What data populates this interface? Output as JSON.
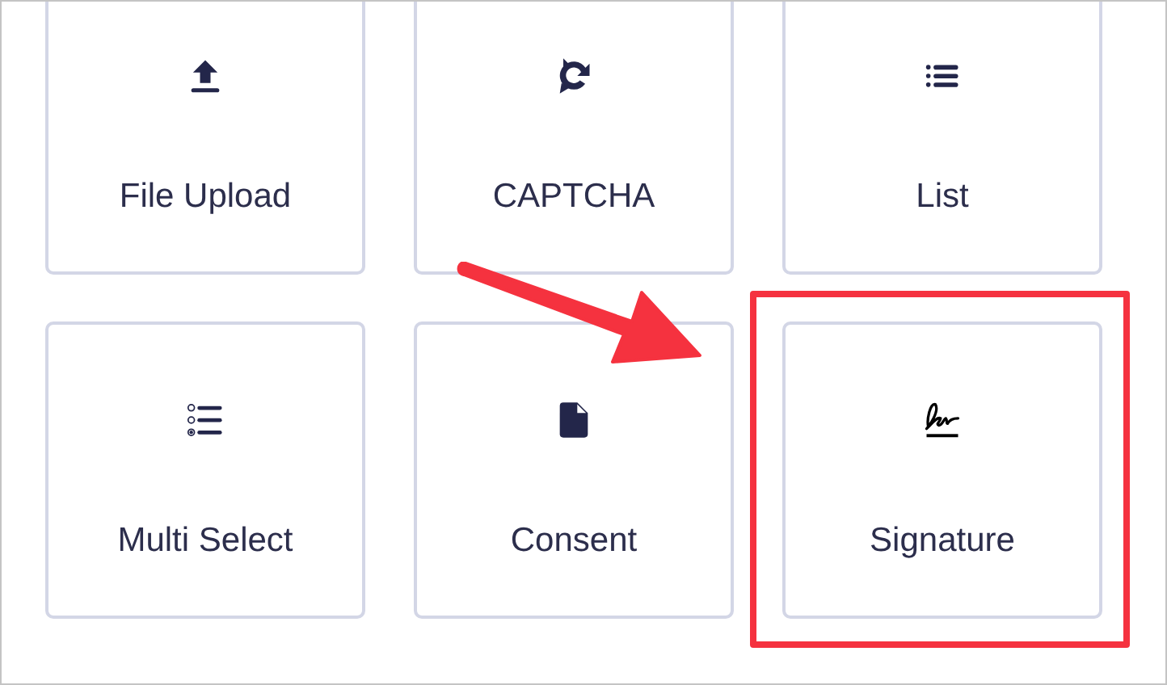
{
  "cards": [
    {
      "label": "File Upload",
      "kind": "upload",
      "highlighted": false
    },
    {
      "label": "CAPTCHA",
      "kind": "captcha",
      "highlighted": false
    },
    {
      "label": "List",
      "kind": "list",
      "highlighted": false
    },
    {
      "label": "Multi Select",
      "kind": "multi-select",
      "highlighted": false
    },
    {
      "label": "Consent",
      "kind": "document",
      "highlighted": false
    },
    {
      "label": "Signature",
      "kind": "signature",
      "highlighted": true
    }
  ],
  "annotation": {
    "kind": "arrow"
  }
}
